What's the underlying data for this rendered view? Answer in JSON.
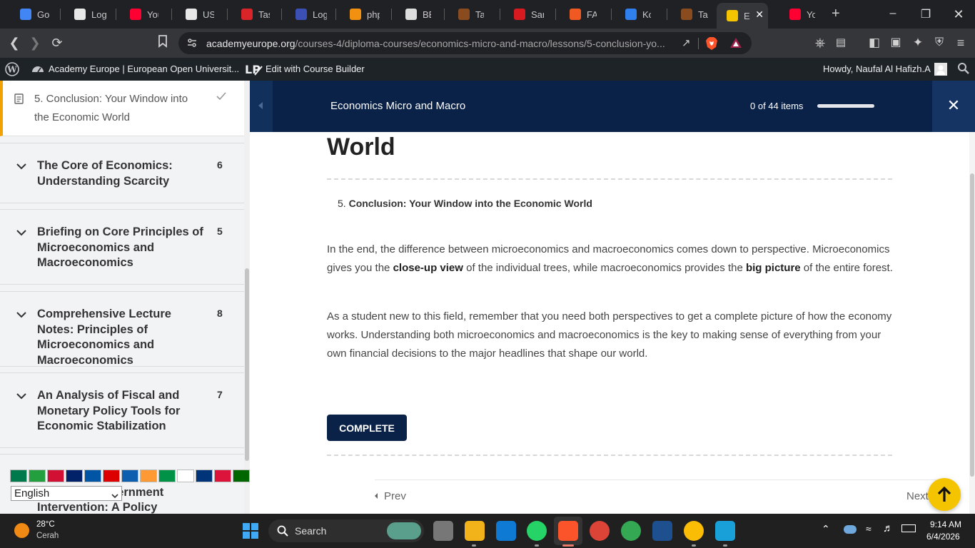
{
  "browser": {
    "tabs": [
      {
        "label": "Goog",
        "color": "#4285f4"
      },
      {
        "label": "Login",
        "color": "#e8e8e8"
      },
      {
        "label": "YouT",
        "color": "#ff0033"
      },
      {
        "label": "USER",
        "color": "#e8e8e8"
      },
      {
        "label": "Tasks",
        "color": "#d9252a"
      },
      {
        "label": "Login",
        "color": "#3b4fb5"
      },
      {
        "label": "phpM",
        "color": "#f29111"
      },
      {
        "label": "BEP F",
        "color": "#dddddd"
      },
      {
        "label": "Tarsiu",
        "color": "#8a4b1f"
      },
      {
        "label": "Same",
        "color": "#d71920"
      },
      {
        "label": "FAJRI",
        "color": "#f05a22"
      },
      {
        "label": "Komi",
        "color": "#2f80ed"
      },
      {
        "label": "Tarsiu",
        "color": "#8a4b1f"
      },
      {
        "label": "E",
        "color": "#f5c400"
      },
      {
        "label": "YouT",
        "color": "#ff0033"
      }
    ],
    "url_host": "academyeurope.org",
    "url_path": "/courses-4/diploma-courses/economics-micro-and-macro/lessons/5-conclusion-yo..."
  },
  "adminbar": {
    "site_name": "Academy Europe | European Open Universit...",
    "course_builder": "Edit with Course Builder",
    "greeting": "Howdy, Naufal Al Hafizh.A"
  },
  "sidebar": {
    "current_lesson": "5. Conclusion: Your Window into the Economic World",
    "sections": [
      {
        "title": "The Core of Economics: Understanding Scarcity",
        "count": "6"
      },
      {
        "title": "Briefing on Core Principles of Microeconomics and Macroeconomics",
        "count": "5"
      },
      {
        "title": "Comprehensive Lecture Notes: Principles of Microeconomics and Macroeconomics",
        "count": "8"
      },
      {
        "title": "An Analysis of Fiscal and Monetary Policy Tools for Economic Stabilization",
        "count": "7"
      },
      {
        "title_line1": "vernment",
        "title_line2": "Intervention: A Policy"
      }
    ]
  },
  "lang_widget": {
    "selected": "English",
    "flags": [
      "#007a4d",
      "#239f40",
      "#d21034",
      "#012169",
      "#0055a4",
      "#dd0000",
      "#0d5eaf",
      "#ff9933",
      "#009246",
      "#ffffff",
      "#003478",
      "#dc143c",
      "#006600",
      "#0039a6",
      "#c60b1e",
      "#e30a17"
    ]
  },
  "course_header": {
    "title": "Economics Micro and Macro",
    "progress_text": "0 of 44 items",
    "progress": 0
  },
  "content": {
    "heading_fragment": "World",
    "toc_number": "5.",
    "toc_title": "Conclusion: Your Window into the Economic World",
    "p1_a": "In the end, the difference between microeconomics and macroeconomics comes down to perspective. Microeconomics gives you the ",
    "p1_b": "close-up view",
    "p1_c": " of the individual trees, while macroeconomics provides the ",
    "p1_d": "big picture",
    "p1_e": " of the entire forest.",
    "p2": "As a student new to this field, remember that you need both perspectives to get a complete picture of how the economy works. Understanding both microeconomics and macroeconomics is the key to making sense of everything from your own financial decisions to the major headlines that shape our world.",
    "complete_button": "COMPLETE",
    "prev": "Prev",
    "next": "Next"
  },
  "taskbar": {
    "temperature": "28°C",
    "weather": "Cerah",
    "search": "Search",
    "time": "9:14 AM",
    "date": "6/4/2026"
  },
  "colors": {
    "course_header": "#0a2148",
    "accent_orange": "#f2a200",
    "scroll_top": "#f5c400"
  }
}
